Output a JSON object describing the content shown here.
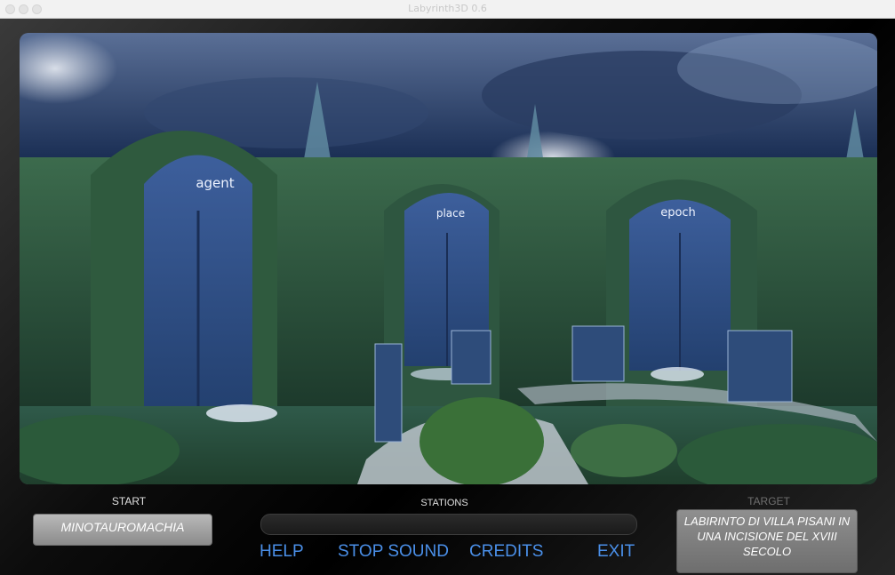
{
  "window": {
    "title": "Labyrinth3D 0.6"
  },
  "scene": {
    "doors": [
      {
        "label": "agent"
      },
      {
        "label": "place"
      },
      {
        "label": "epoch"
      }
    ]
  },
  "hud": {
    "start_label": "START",
    "start_value": "MINOTAUROMACHIA",
    "stations_label": "STATIONS",
    "target_label": "TARGET",
    "target_value": "LABIRINTO DI VILLA PISANI IN UNA INCISIONE DEL XVIII SECOLO"
  },
  "menu": {
    "help": "HELP",
    "stop_sound": "STOP SOUND",
    "credits": "CREDITS",
    "exit": "EXIT"
  },
  "colors": {
    "menu_text": "#4a8fe8",
    "hedge": "#2f5a3e",
    "door": "#2d4a80"
  }
}
